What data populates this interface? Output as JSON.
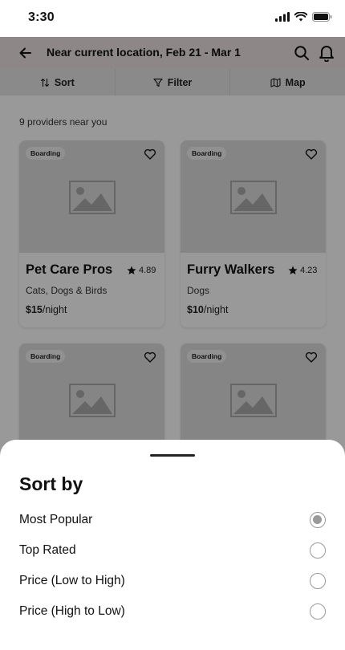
{
  "status_bar": {
    "time": "3:30"
  },
  "header": {
    "title": "Near current location, Feb 21 - Mar 1"
  },
  "toolbar": {
    "sort_label": "Sort",
    "filter_label": "Filter",
    "map_label": "Map"
  },
  "results": {
    "count_text": "9 providers near you",
    "providers": [
      {
        "badge": "Boarding",
        "name": "Pet Care Pros",
        "rating": "4.89",
        "pets": "Cats, Dogs & Birds",
        "price": "$15",
        "price_unit": "/night"
      },
      {
        "badge": "Boarding",
        "name": "Furry Walkers",
        "rating": "4.23",
        "pets": "Dogs",
        "price": "$10",
        "price_unit": "/night"
      },
      {
        "badge": "Boarding"
      },
      {
        "badge": "Boarding"
      }
    ]
  },
  "sort_sheet": {
    "heading": "Sort by",
    "options": [
      {
        "label": "Most Popular",
        "selected": true
      },
      {
        "label": "Top Rated",
        "selected": false
      },
      {
        "label": "Price (Low to High)",
        "selected": false
      },
      {
        "label": "Price (High to Low)",
        "selected": false
      }
    ]
  },
  "colors": {
    "header_bg": "#ebe2e2",
    "overlay": "rgba(0,0,0,0.4)",
    "radio_selected": "#9a9a9a"
  },
  "icons": [
    "signal-icon",
    "wifi-icon",
    "battery-icon",
    "back-arrow-icon",
    "search-icon",
    "bell-icon",
    "sort-icon",
    "filter-icon",
    "map-icon",
    "heart-icon",
    "image-placeholder-icon",
    "star-icon"
  ]
}
